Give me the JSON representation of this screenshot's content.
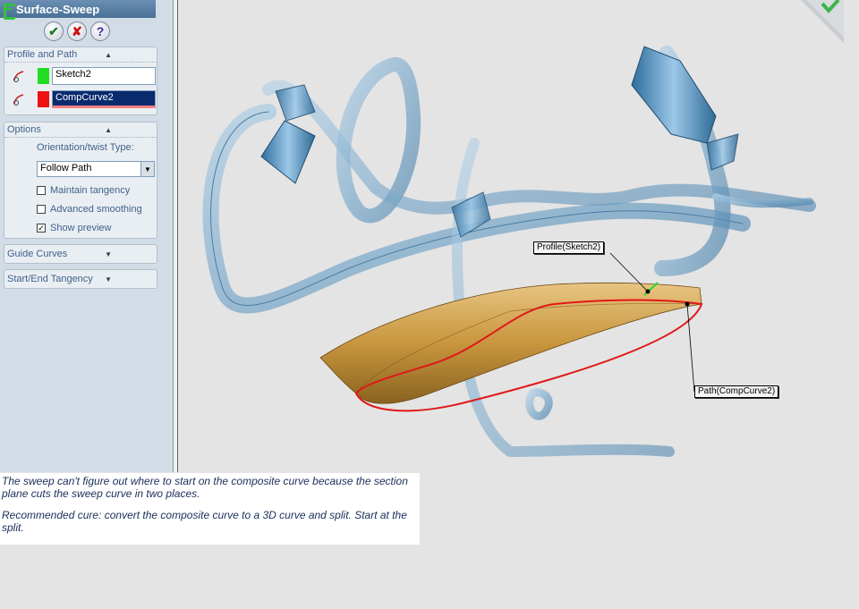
{
  "feature": {
    "title": "Surface-Sweep",
    "buttons": {
      "ok": "✔",
      "cancel": "✘",
      "help": "?"
    },
    "colors": {
      "title_bar": "#4a7096",
      "ok": "#1f7f2a",
      "cancel": "#cc1111",
      "help": "#3a2a9c"
    }
  },
  "profile_and_path": {
    "header": "Profile and Path",
    "profile_selection": "Sketch2",
    "path_selection": "CompCurve2",
    "profile_swatch_color": "#22dd22",
    "path_swatch_color": "#ee1111"
  },
  "options": {
    "header": "Options",
    "orientation_label": "Orientation/twist Type:",
    "orientation_value": "Follow Path",
    "checkboxes": [
      {
        "label": "Maintain tangency",
        "checked": false
      },
      {
        "label": "Advanced smoothing",
        "checked": false
      },
      {
        "label": "Show preview",
        "checked": true
      }
    ]
  },
  "guide_curves": {
    "header": "Guide Curves"
  },
  "start_end_tangency": {
    "header": "Start/End Tangency"
  },
  "callouts": {
    "profile": "Profile(Sketch2)",
    "path": "Path(CompCurve2)"
  },
  "note": {
    "line1": "The sweep can't figure out where to start on the composite curve because the section plane cuts the sweep curve in two places.",
    "line2": "Recommended cure: convert the composite curve to a 3D curve and split. Start at the split."
  }
}
